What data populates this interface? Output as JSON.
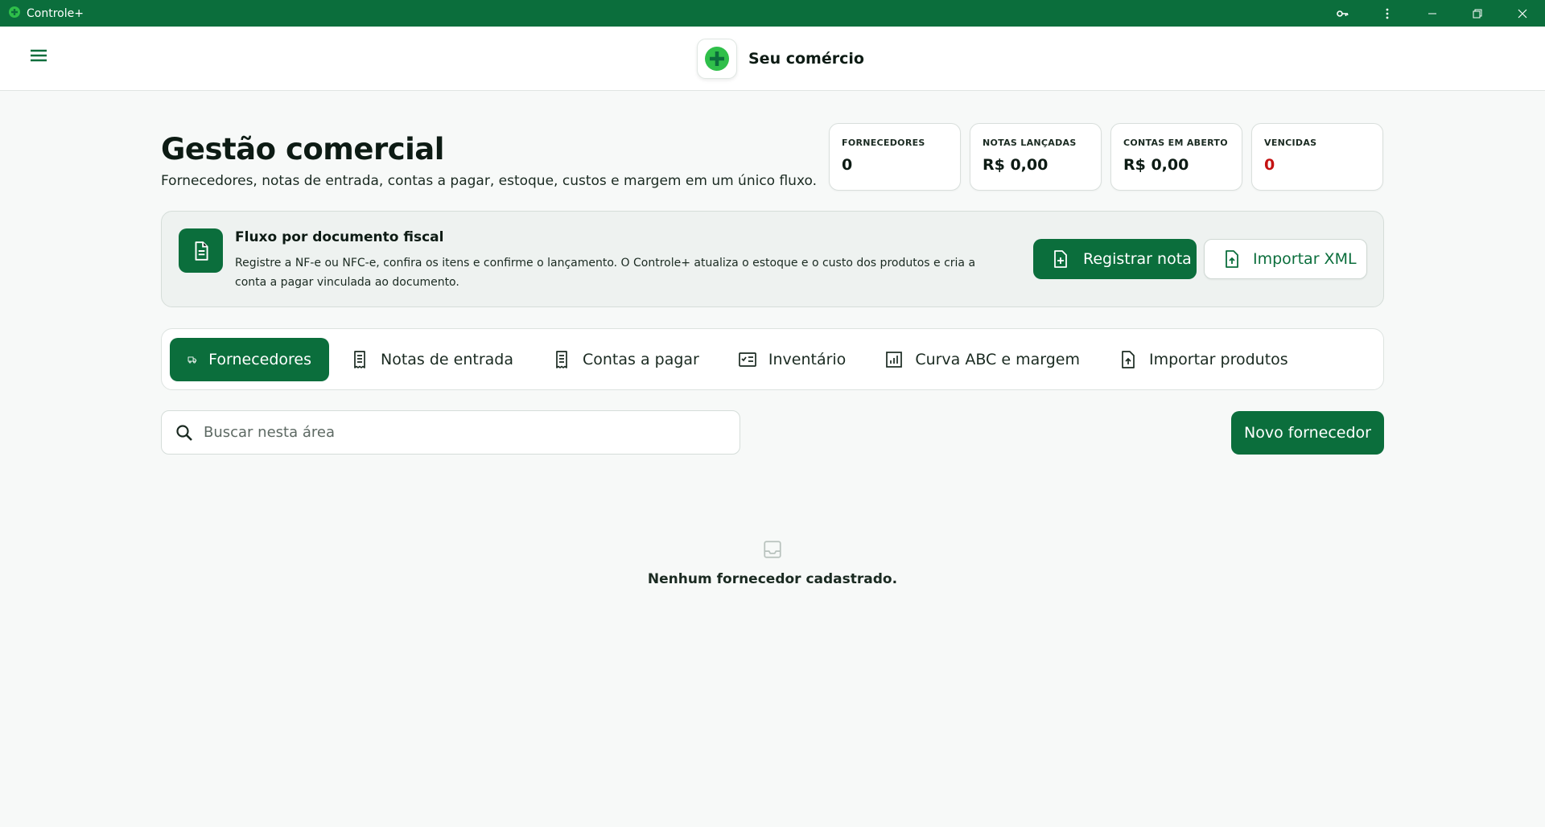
{
  "window": {
    "title": "Controle+"
  },
  "header": {
    "brand_name": "Seu comércio"
  },
  "hero": {
    "title": "Gestão comercial",
    "subtitle": "Fornecedores, notas de entrada, contas a pagar, estoque, custos e margem em um único fluxo."
  },
  "stats": [
    {
      "label": "FORNECEDORES",
      "value": "0"
    },
    {
      "label": "NOTAS LANÇADAS",
      "value": "R$ 0,00"
    },
    {
      "label": "CONTAS EM ABERTO",
      "value": "R$ 0,00"
    },
    {
      "label": "VENCIDAS",
      "value": "0"
    }
  ],
  "flow": {
    "title": "Fluxo por documento fiscal",
    "text": "Registre a NF-e ou NFC-e, confira os itens e confirme o lançamento. O Controle+ atualiza o estoque e o custo dos produtos e cria a conta a pagar vinculada ao documento.",
    "primary_label": "Registrar nota",
    "secondary_label": "Importar XML"
  },
  "tabs": [
    {
      "label": "Fornecedores",
      "icon": "truck-icon",
      "active": true
    },
    {
      "label": "Notas de entrada",
      "icon": "receipt-icon"
    },
    {
      "label": "Contas a pagar",
      "icon": "receipt-icon"
    },
    {
      "label": "Inventário",
      "icon": "checklist-icon"
    },
    {
      "label": "Curva ABC e margem",
      "icon": "chart-icon"
    },
    {
      "label": "Importar produtos",
      "icon": "file-upload-icon"
    }
  ],
  "search": {
    "placeholder": "Buscar nesta área",
    "value": ""
  },
  "actions": {
    "new_label": "Novo fornecedor"
  },
  "empty_state": {
    "message": "Nenhum fornecedor cadastrado."
  },
  "colors": {
    "primary": "#0b6e3c",
    "danger": "#c41212",
    "accent": "#2fbf4a"
  }
}
